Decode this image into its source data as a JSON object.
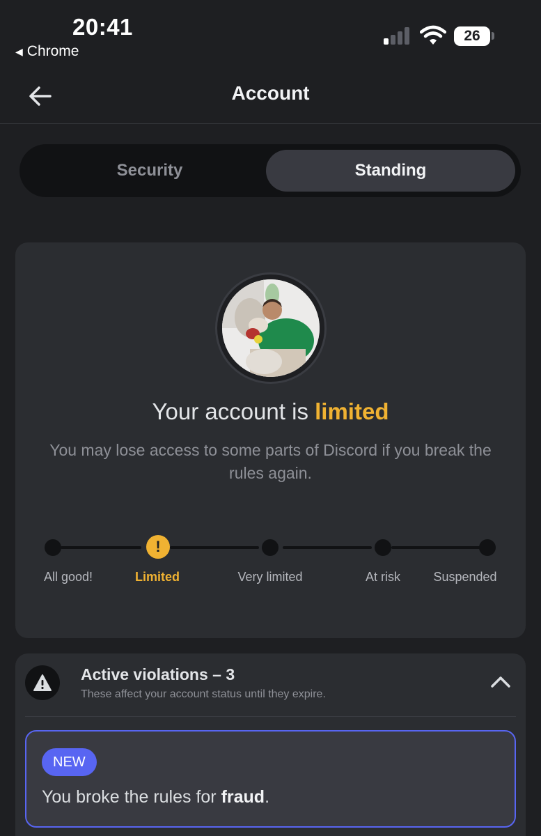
{
  "status_bar": {
    "time": "20:41",
    "back_app": "Chrome",
    "battery": "26"
  },
  "header": {
    "title": "Account"
  },
  "tabs": [
    {
      "label": "Security",
      "selected": false
    },
    {
      "label": "Standing",
      "selected": true
    }
  ],
  "standing": {
    "headline_prefix": "Your account is ",
    "headline_status": "limited",
    "description": "You may lose access to some parts of Discord if you break the rules again.",
    "steps": [
      "All good!",
      "Limited",
      "Very limited",
      "At risk",
      "Suspended"
    ],
    "current_step": "Limited",
    "accent_color": "#f0b232"
  },
  "violations": {
    "title": "Active violations – 3",
    "subtitle": "These affect your account status until they expire.",
    "items": [
      {
        "badge": "NEW",
        "text_prefix": "You broke the rules for ",
        "text_emphasis": "fraud",
        "text_suffix": "."
      }
    ]
  },
  "colors": {
    "background": "#1e1f22",
    "card": "#2b2d31",
    "brand": "#5865f2",
    "warning": "#f0b232"
  }
}
